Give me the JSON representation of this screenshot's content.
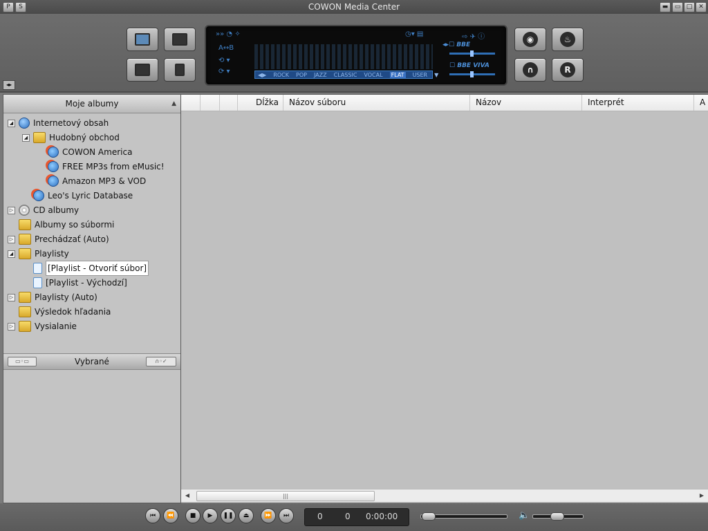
{
  "window": {
    "title": "COWON Media Center"
  },
  "titlebar_buttons": [
    {
      "icon": "pin-icon",
      "glyph": "P"
    },
    {
      "icon": "skin-icon",
      "glyph": "S"
    },
    {
      "icon": "minimize-icon",
      "glyph": "▬"
    },
    {
      "icon": "restore-icon",
      "glyph": "▭"
    },
    {
      "icon": "maximize-icon",
      "glyph": "□"
    },
    {
      "icon": "close-icon",
      "glyph": "✕"
    }
  ],
  "lcd": {
    "ab_repeat": "A↔B",
    "presets": [
      "ROCK",
      "POP",
      "JAZZ",
      "CLASSIC",
      "VOCAL",
      "FLAT",
      "USER"
    ],
    "selected_preset": "FLAT",
    "effect1": "BBE",
    "effect2": "BBE VIVA"
  },
  "side_buttons": {
    "record_label": "R"
  },
  "left_panel": {
    "header": "Moje albumy",
    "tree": [
      {
        "label": "Internetový obsah",
        "level": 0,
        "icon": "globe-icon",
        "expander": "◢"
      },
      {
        "label": "Hudobný obchod",
        "level": 1,
        "icon": "web-folder-icon",
        "expander": "◢"
      },
      {
        "label": "COWON America",
        "level": 2,
        "icon": "web-link-icon",
        "expander": ""
      },
      {
        "label": "FREE MP3s from eMusic!",
        "level": 2,
        "icon": "web-link-icon",
        "expander": ""
      },
      {
        "label": "Amazon MP3 & VOD",
        "level": 2,
        "icon": "web-link-icon",
        "expander": ""
      },
      {
        "label": "Leo's Lyric Database",
        "level": 1,
        "icon": "web-link-icon",
        "expander": ""
      },
      {
        "label": "CD albumy",
        "level": 0,
        "icon": "cd-icon",
        "expander": "▷"
      },
      {
        "label": "Albumy so súbormi",
        "level": 0,
        "icon": "folder-icon",
        "expander": ""
      },
      {
        "label": "Prechádzať (Auto)",
        "level": 0,
        "icon": "folder-icon",
        "expander": "▷"
      },
      {
        "label": "Playlisty",
        "level": 0,
        "icon": "folder-icon",
        "expander": "◢"
      },
      {
        "label": "[Playlist - Otvoriť súbor]",
        "level": 1,
        "icon": "playlist-icon",
        "expander": "",
        "selected": true
      },
      {
        "label": "[Playlist - Východzí]",
        "level": 1,
        "icon": "playlist-icon",
        "expander": ""
      },
      {
        "label": "Playlisty (Auto)",
        "level": 0,
        "icon": "folder-icon",
        "expander": "▷"
      },
      {
        "label": "Výsledok hľadania",
        "level": 0,
        "icon": "folder-icon",
        "expander": ""
      },
      {
        "label": "Vysialanie",
        "level": 0,
        "icon": "folder-icon",
        "expander": "▷"
      }
    ],
    "selected_header": "Vybrané"
  },
  "columns": [
    "",
    "",
    "",
    "Dĺžka",
    "Názov súboru",
    "Názov",
    "Interprét",
    "A"
  ],
  "counter": {
    "a": "0",
    "b": "0",
    "time": "0:00:00"
  },
  "colors": {
    "lcd_accent": "#3f7fc4",
    "panel": "#c4c4c4"
  }
}
